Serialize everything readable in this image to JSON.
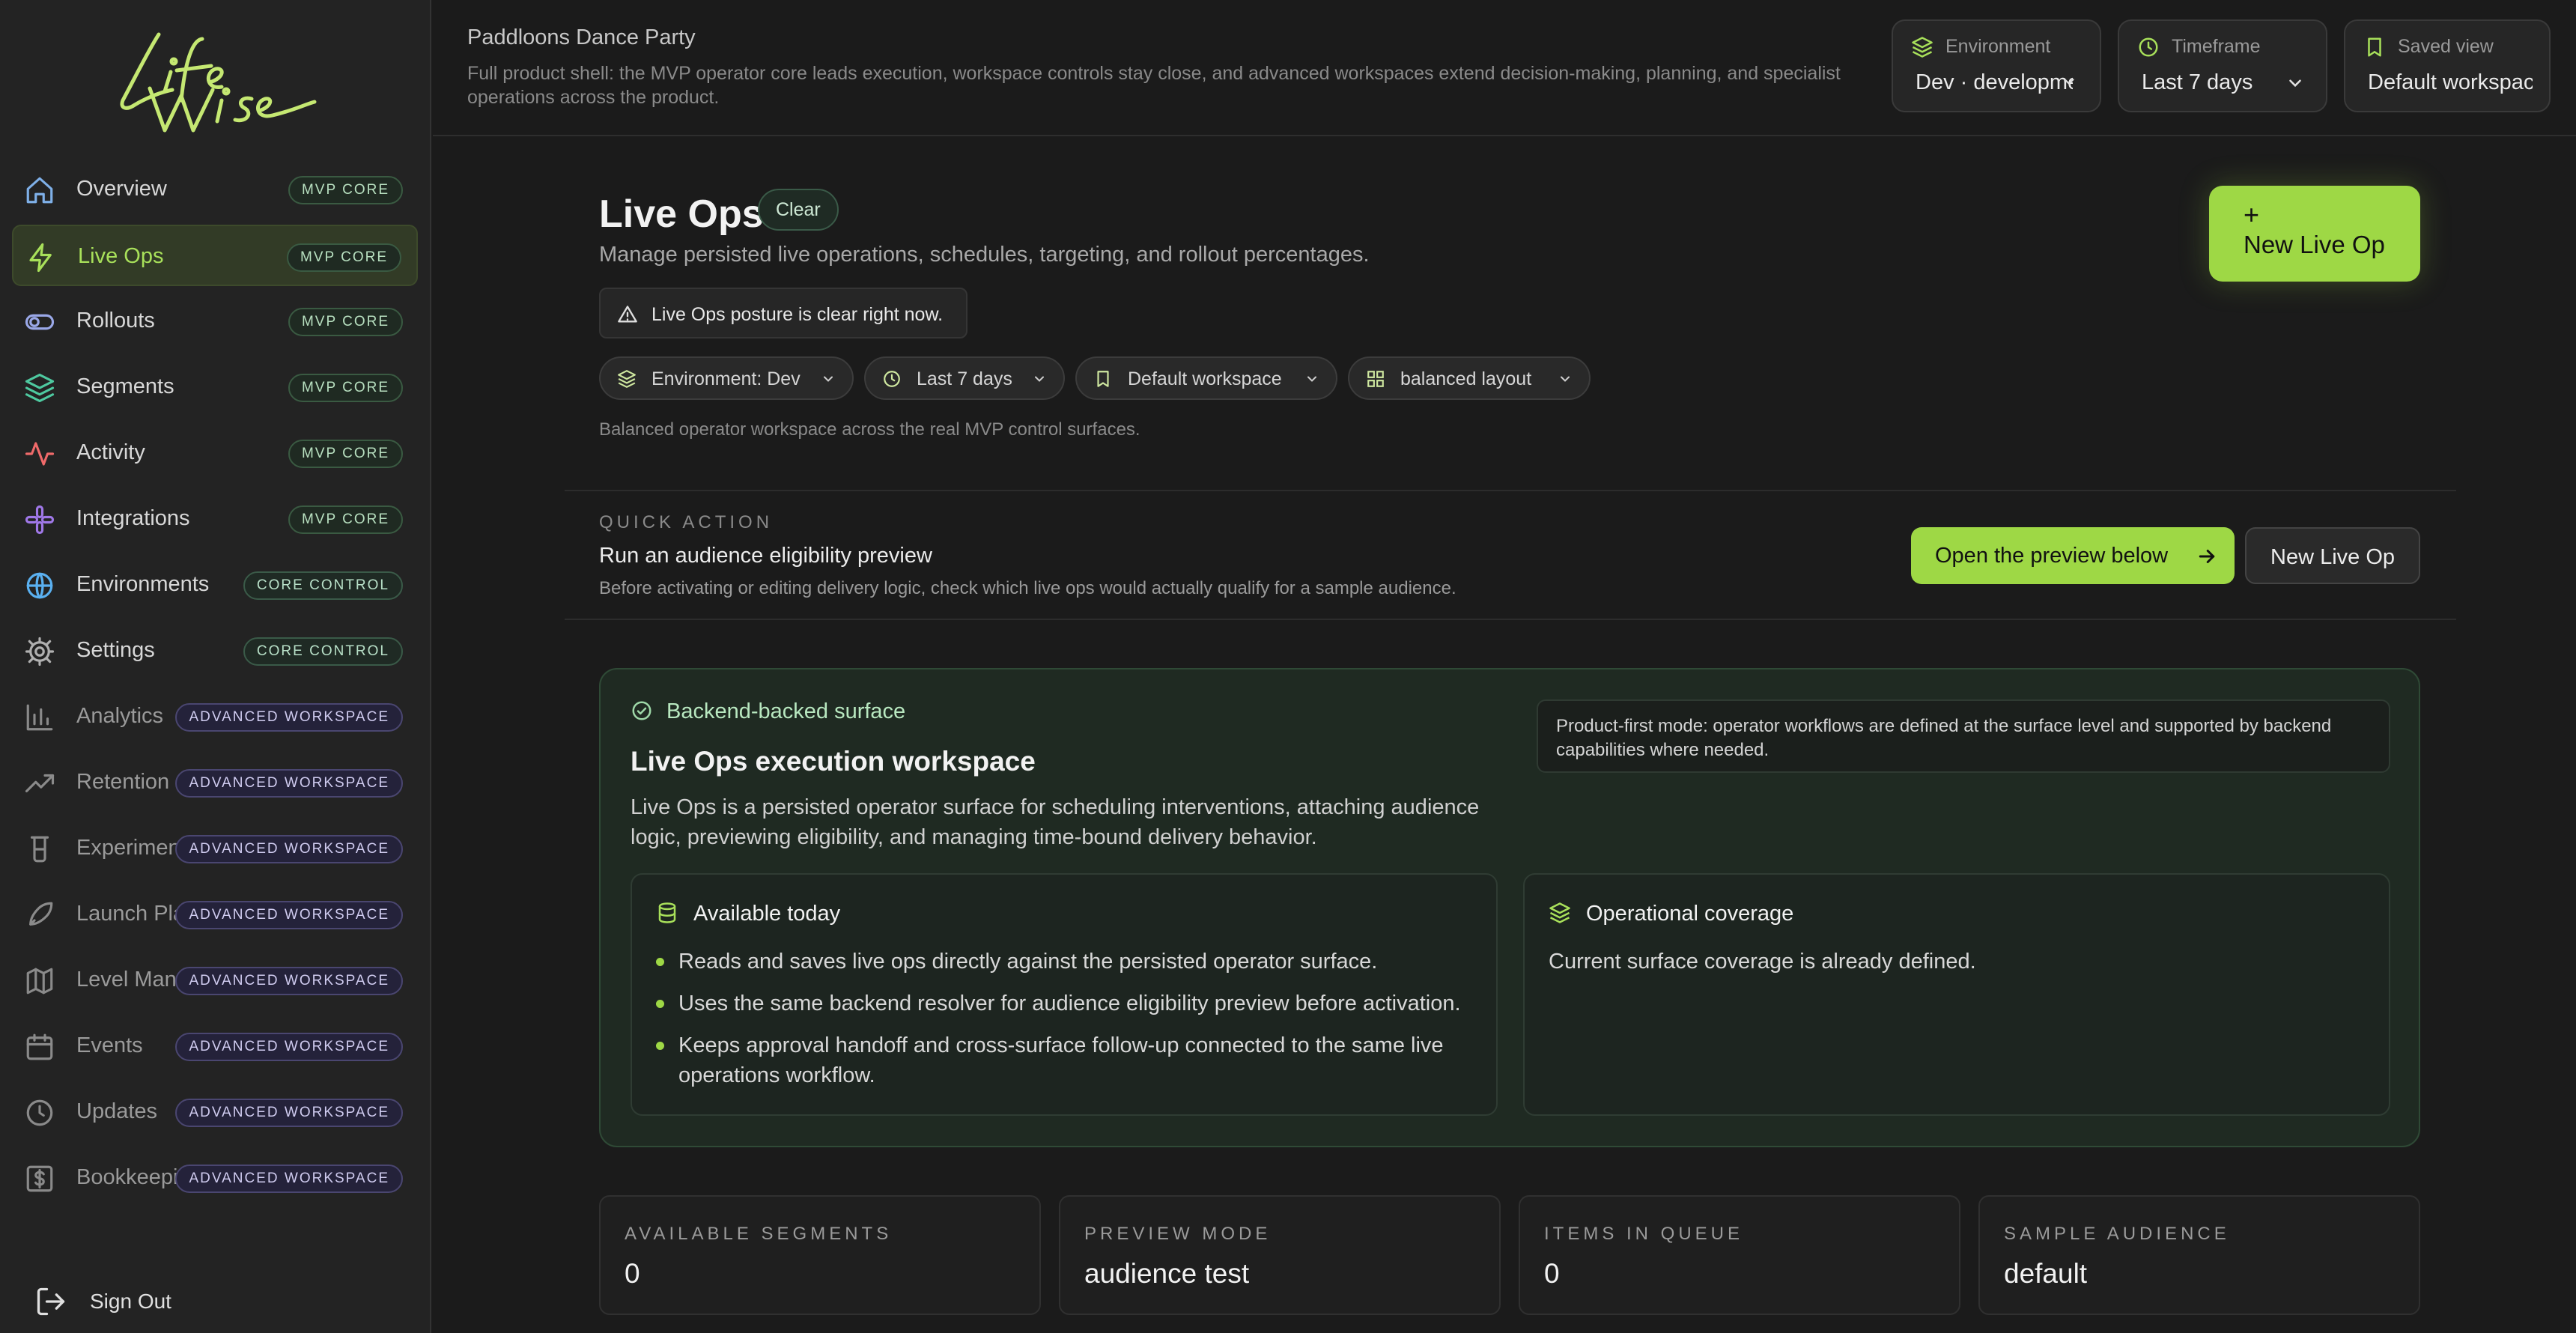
{
  "brand": {
    "logo_text": "LifeWise",
    "accent": "#9ed845"
  },
  "sidebar": {
    "items": [
      {
        "label": "Overview",
        "badge": "MVP CORE",
        "icon": "home-icon",
        "active": false
      },
      {
        "label": "Live Ops",
        "badge": "MVP CORE",
        "icon": "lightning-icon",
        "active": true
      },
      {
        "label": "Rollouts",
        "badge": "MVP CORE",
        "icon": "toggle-icon",
        "active": false
      },
      {
        "label": "Segments",
        "badge": "MVP CORE",
        "icon": "layers-icon",
        "active": false
      },
      {
        "label": "Activity",
        "badge": "MVP CORE",
        "icon": "pulse-icon",
        "active": false
      },
      {
        "label": "Integrations",
        "badge": "MVP CORE",
        "icon": "slack-icon",
        "active": false
      },
      {
        "label": "Environments",
        "badge": "CORE CONTROL",
        "icon": "globe-icon",
        "active": false
      },
      {
        "label": "Settings",
        "badge": "CORE CONTROL",
        "icon": "gear-icon",
        "active": false
      },
      {
        "label": "Analytics",
        "badge": "ADVANCED WORKSPACE",
        "icon": "bar-chart-icon",
        "active": false
      },
      {
        "label": "Retention",
        "badge": "ADVANCED WORKSPACE",
        "icon": "trend-up-icon",
        "active": false
      },
      {
        "label": "Experiments",
        "badge": "ADVANCED WORKSPACE",
        "icon": "beaker-icon",
        "active": false
      },
      {
        "label": "Launch Planning",
        "badge": "ADVANCED WORKSPACE",
        "icon": "rocket-icon",
        "active": false
      },
      {
        "label": "Level Management",
        "badge": "ADVANCED WORKSPACE",
        "icon": "map-icon",
        "active": false
      },
      {
        "label": "Events",
        "badge": "ADVANCED WORKSPACE",
        "icon": "calendar-icon",
        "active": false
      },
      {
        "label": "Updates",
        "badge": "ADVANCED WORKSPACE",
        "icon": "clock-icon",
        "active": false
      },
      {
        "label": "Bookkeeping",
        "badge": "ADVANCED WORKSPACE",
        "icon": "dollar-icon",
        "active": false
      }
    ],
    "sign_out": "Sign Out"
  },
  "header": {
    "app_name": "Paddloons Dance Party",
    "description": "Full product shell: the MVP operator core leads execution, workspace controls stay close, and advanced workspaces extend decision-making, planning, and specialist operations across the product.",
    "environment": {
      "label": "Environment",
      "value": "Dev · development"
    },
    "timeframe": {
      "label": "Timeframe",
      "value": "Last 7 days"
    },
    "saved_view": {
      "label": "Saved view",
      "value": "Default workspace"
    }
  },
  "page": {
    "title": "Live Ops",
    "status": "Clear",
    "subtitle": "Manage persisted live operations, schedules, targeting, and rollout percentages.",
    "new_button_plus": "+",
    "new_button": "New Live Op",
    "alert": "Live Ops posture is clear right now.",
    "chips": {
      "environment": "Environment: Dev",
      "timeframe": "Last 7 days",
      "workspace": "Default workspace",
      "layout": "balanced layout"
    },
    "layout_note": "Balanced operator workspace across the real MVP control surfaces."
  },
  "quick_action": {
    "label": "QUICK ACTION",
    "title": "Run an audience eligibility preview",
    "description": "Before activating or editing delivery logic, check which live ops would actually qualify for a sample audience.",
    "primary": "Open the preview below",
    "secondary": "New Live Op"
  },
  "workspace": {
    "tag": "Backend-backed surface",
    "title": "Live Ops execution workspace",
    "description": "Live Ops is a persisted operator surface for scheduling interventions, attaching audience logic, previewing eligibility, and managing time-bound delivery behavior.",
    "note": "Product-first mode: operator workflows are defined at the surface level and supported by backend capabilities where needed.",
    "available": {
      "title": "Available today",
      "items": [
        "Reads and saves live ops directly against the persisted operator surface.",
        "Uses the same backend resolver for audience eligibility preview before activation.",
        "Keeps approval handoff and cross-surface follow-up connected to the same live operations workflow."
      ]
    },
    "coverage": {
      "title": "Operational coverage",
      "text": "Current surface coverage is already defined."
    }
  },
  "stats": [
    {
      "label": "AVAILABLE SEGMENTS",
      "value": "0"
    },
    {
      "label": "PREVIEW MODE",
      "value": "audience test"
    },
    {
      "label": "ITEMS IN QUEUE",
      "value": "0"
    },
    {
      "label": "SAMPLE AUDIENCE",
      "value": "default"
    }
  ]
}
